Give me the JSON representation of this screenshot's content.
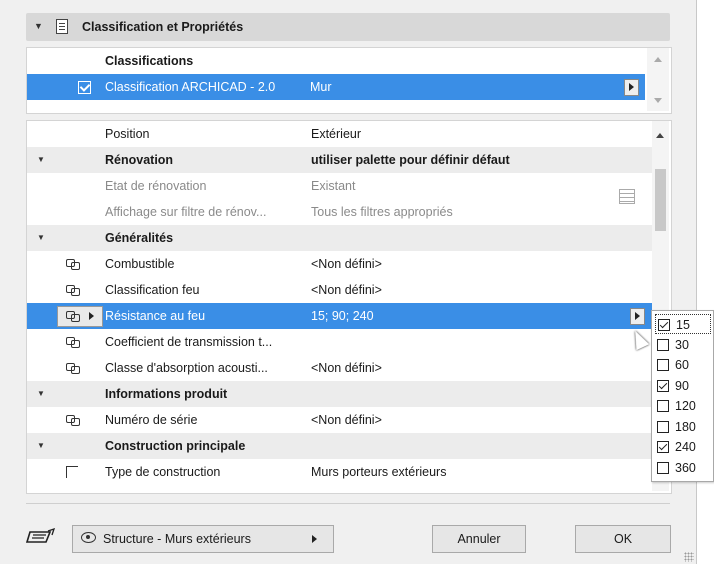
{
  "section": {
    "title": "Classification et Propriétés"
  },
  "classifications": {
    "header": "Classifications",
    "row": {
      "system": "Classification ARCHICAD - 2.0",
      "value": "Mur"
    }
  },
  "properties": {
    "rows": [
      {
        "label": "Position",
        "value": "Extérieur",
        "kind": "plain"
      },
      {
        "label": "Rénovation",
        "value": "utiliser palette pour définir défaut",
        "kind": "group"
      },
      {
        "label": "Etat de rénovation",
        "value": "Existant",
        "kind": "gray"
      },
      {
        "label": "Affichage sur filtre de rénov...",
        "value": "Tous les filtres appropriés",
        "kind": "gray"
      },
      {
        "label": "Généralités",
        "value": "",
        "kind": "group"
      },
      {
        "label": "Combustible",
        "value": "<Non défini>",
        "kind": "linked"
      },
      {
        "label": "Classification feu",
        "value": "<Non défini>",
        "kind": "linked"
      },
      {
        "label": "Résistance au feu",
        "value": "15; 90; 240",
        "kind": "selected"
      },
      {
        "label": "Coefficient de transmission t...",
        "value": "",
        "kind": "linked"
      },
      {
        "label": "Classe d'absorption acousti...",
        "value": "<Non défini>",
        "kind": "linked"
      },
      {
        "label": "Informations produit",
        "value": "",
        "kind": "group"
      },
      {
        "label": "Numéro de série",
        "value": "<Non défini>",
        "kind": "linked"
      },
      {
        "label": "Construction principale",
        "value": "",
        "kind": "group"
      },
      {
        "label": "Type de construction",
        "value": "Murs porteurs extérieurs",
        "kind": "linked2"
      }
    ]
  },
  "popup": {
    "options": [
      {
        "label": "15",
        "checked": true
      },
      {
        "label": "30",
        "checked": false
      },
      {
        "label": "60",
        "checked": false
      },
      {
        "label": "90",
        "checked": true
      },
      {
        "label": "120",
        "checked": false
      },
      {
        "label": "180",
        "checked": false
      },
      {
        "label": "240",
        "checked": true
      },
      {
        "label": "360",
        "checked": false
      }
    ]
  },
  "footer": {
    "favorite": "Structure - Murs extérieurs",
    "cancel": "Annuler",
    "ok": "OK"
  },
  "colors": {
    "selection": "#3a8ee6",
    "panel": "#f0f0f0"
  }
}
